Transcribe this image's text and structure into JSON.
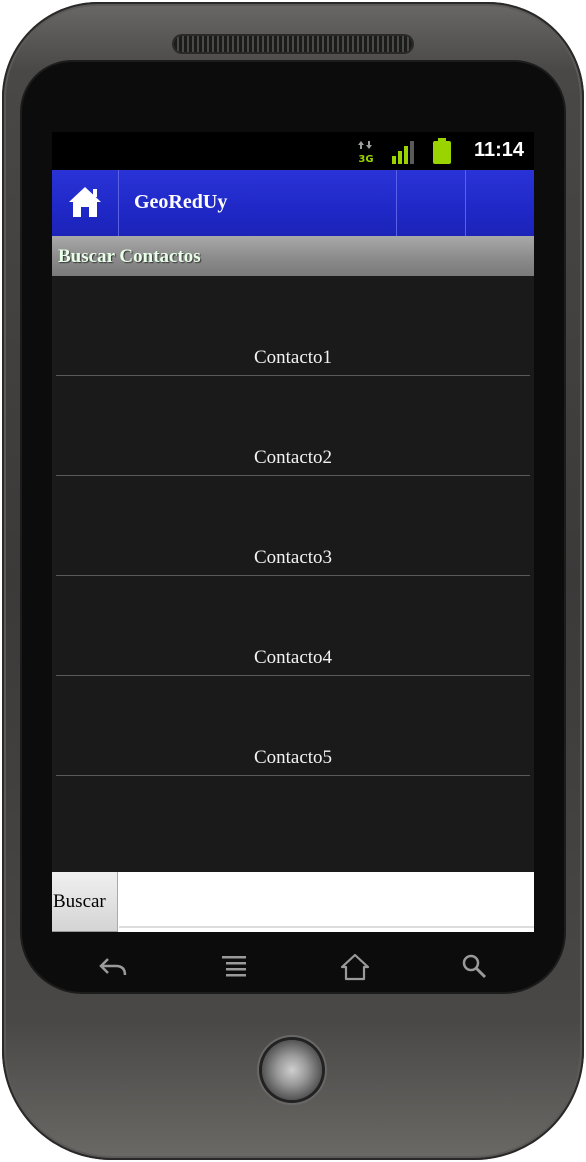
{
  "status_bar": {
    "time": "11:14",
    "network_label": "3G",
    "icons": [
      "data-3g-icon",
      "signal-icon",
      "battery-icon"
    ]
  },
  "app_bar": {
    "title": "GeoRedUy",
    "home_icon": "home-icon",
    "color": "#2029c8"
  },
  "section": {
    "title": "Buscar Contactos"
  },
  "contacts": [
    {
      "label": "Contacto1"
    },
    {
      "label": "Contacto2"
    },
    {
      "label": "Contacto3"
    },
    {
      "label": "Contacto4"
    },
    {
      "label": "Contacto5"
    }
  ],
  "search": {
    "button_label": "Buscar",
    "value": "",
    "placeholder": ""
  },
  "nav_keys": [
    "back-icon",
    "menu-icon",
    "home-icon",
    "search-icon"
  ]
}
